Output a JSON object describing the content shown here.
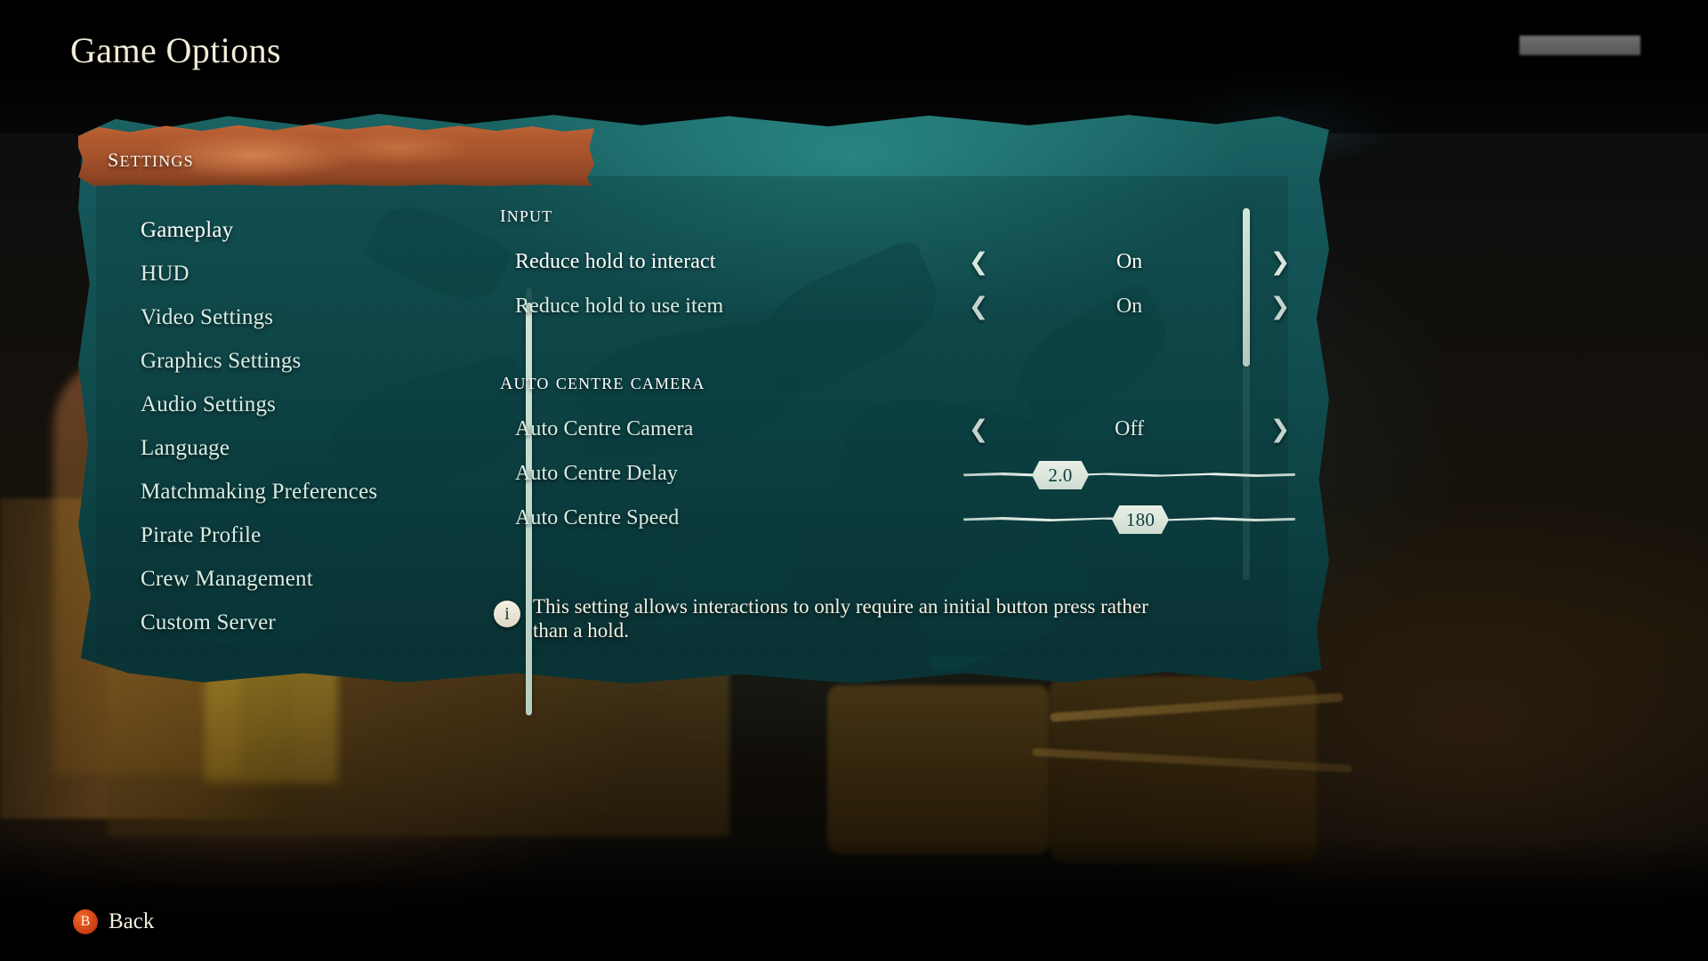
{
  "header": {
    "title": "Game Options"
  },
  "banner": {
    "label": "Settings"
  },
  "sidebar": {
    "items": [
      {
        "label": "Gameplay",
        "selected": true
      },
      {
        "label": "HUD",
        "selected": false
      },
      {
        "label": "Video Settings",
        "selected": false
      },
      {
        "label": "Graphics Settings",
        "selected": false
      },
      {
        "label": "Audio Settings",
        "selected": false
      },
      {
        "label": "Language",
        "selected": false
      },
      {
        "label": "Matchmaking Preferences",
        "selected": false
      },
      {
        "label": "Pirate Profile",
        "selected": false
      },
      {
        "label": "Crew Management",
        "selected": false
      },
      {
        "label": "Custom Server",
        "selected": false
      }
    ]
  },
  "sections": [
    {
      "heading": "Input",
      "options": [
        {
          "label": "Reduce hold to interact",
          "type": "stepper",
          "value": "On",
          "left_arrow": "❮",
          "right_arrow": "❯",
          "selected": true
        },
        {
          "label": "Reduce hold to use item",
          "type": "stepper",
          "value": "On",
          "left_arrow": "❮",
          "right_arrow": "❯",
          "selected": false
        }
      ]
    },
    {
      "heading": "Auto Centre Camera",
      "options": [
        {
          "label": "Auto Centre Camera",
          "type": "stepper",
          "value": "Off",
          "left_arrow": "❮",
          "right_arrow": "❯",
          "selected": false
        },
        {
          "label": "Auto Centre Delay",
          "type": "slider",
          "value": "2.0",
          "fill_percent": 25,
          "selected": false
        },
        {
          "label": "Auto Centre Speed",
          "type": "slider",
          "value": "180",
          "fill_percent": 54,
          "selected": false
        }
      ]
    }
  ],
  "info": {
    "icon": "info-icon",
    "text": "This setting allows interactions to only require an initial button press rather than a hold."
  },
  "footer": {
    "back_button_glyph": "B",
    "back_label": "Back"
  },
  "colors": {
    "panel_teal": "#125052",
    "banner_orange": "#b25a30",
    "highlight_dark": "#0a3133",
    "text_cream": "#f4f0e2",
    "text_teal_light": "#d9ece3",
    "slider_track": "#e6efe7",
    "back_badge": "#c93d10"
  }
}
